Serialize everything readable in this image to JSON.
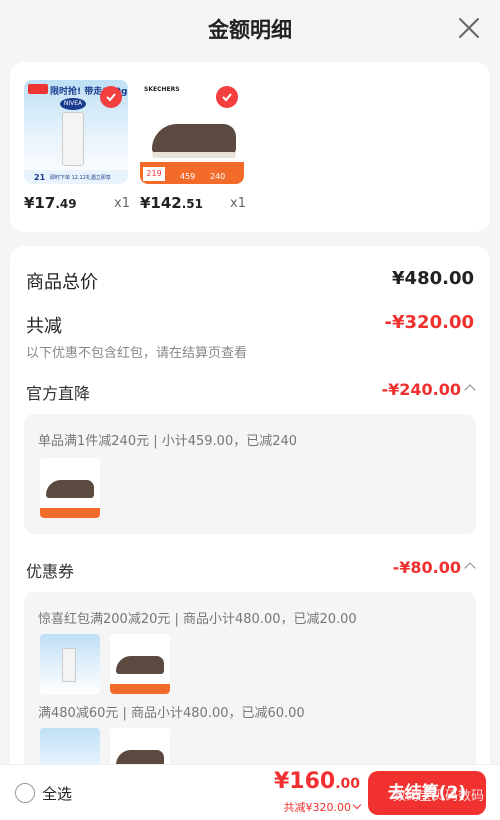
{
  "header": {
    "title": "金额明细"
  },
  "products": [
    {
      "price_int": "¥17",
      "price_dec": ".49",
      "qty": "x1",
      "brand": "NIVEA",
      "promo": "限时抢! 带走100g",
      "badge": "21",
      "footer_text": "即时下单 12.12礼遇立即享"
    },
    {
      "price_int": "¥142",
      "price_dec": ".51",
      "qty": "x1",
      "brand": "SKECHERS",
      "tag_price": "219",
      "tag_a": "459",
      "tag_b": "240"
    }
  ],
  "summary": {
    "total_label": "商品总价",
    "total_value": "¥480.00",
    "discount_label": "共减",
    "discount_value": "-¥320.00",
    "discount_note": "以下优惠不包含红包，请在结算页查看"
  },
  "official": {
    "label": "官方直降",
    "value": "-¥240.00",
    "desc": "单品满1件减240元 | 小计459.00，已减240"
  },
  "coupon": {
    "label": "优惠券",
    "value": "-¥80.00",
    "desc1": "惊喜红包满200减20元 | 商品小计480.00，已减20.00",
    "desc2": "满480减60元 | 商品小计480.00，已减60.00"
  },
  "footer": {
    "select_all": "全选",
    "total_int": "¥160",
    "total_dec": ".00",
    "saved": "共减¥320.00",
    "checkout": "去结算(2)",
    "watermark": "数码宝贝码数码"
  },
  "colors": {
    "accent": "#f0312f",
    "bg": "#f5f5f5"
  }
}
